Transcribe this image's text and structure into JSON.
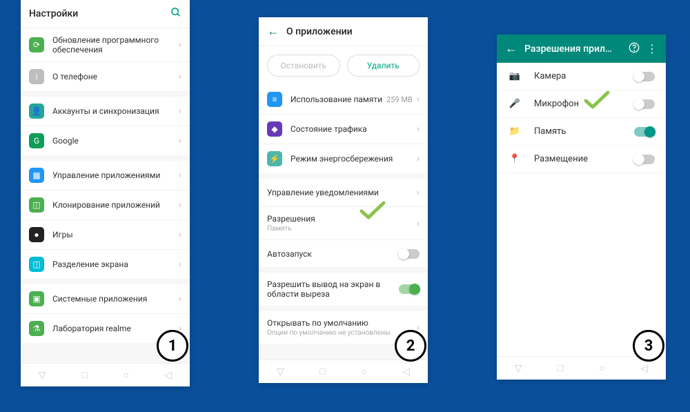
{
  "phone1": {
    "title": "Настройки",
    "groups": [
      [
        {
          "icon": "ic-green",
          "glyph": "⟳",
          "label": "Обновление программного обеспечения"
        },
        {
          "icon": "ic-gray",
          "glyph": "i",
          "label": "О телефоне"
        }
      ],
      [
        {
          "icon": "ic-teal",
          "glyph": "👤",
          "label": "Аккаунты и синхронизация"
        },
        {
          "icon": "ic-ggreen",
          "glyph": "G",
          "label": "Google"
        }
      ],
      [
        {
          "icon": "ic-blue",
          "glyph": "▦",
          "label": "Управление приложениями"
        },
        {
          "icon": "ic-green",
          "glyph": "◫",
          "label": "Клонирование приложений"
        },
        {
          "icon": "ic-dark",
          "glyph": "●",
          "label": "Игры"
        },
        {
          "icon": "ic-cyan",
          "glyph": "◫",
          "label": "Разделение экрана"
        }
      ],
      [
        {
          "icon": "ic-green",
          "glyph": "▣",
          "label": "Системные приложения"
        },
        {
          "icon": "ic-green",
          "glyph": "⚗",
          "label": "Лаборатория realme"
        }
      ]
    ]
  },
  "phone2": {
    "title": "О приложении",
    "btnStop": "Остановить",
    "btnDelete": "Удалить",
    "group1": [
      {
        "icon": "ic-blue",
        "glyph": "≡",
        "label": "Использование памяти",
        "value": "259 MB"
      },
      {
        "icon": "ic-purple",
        "glyph": "◆",
        "label": "Состояние трафика"
      },
      {
        "icon": "ic-mint",
        "glyph": "⚡",
        "label": "Режим энергосбережения"
      }
    ],
    "group2": [
      {
        "label": "Управление уведомлениями",
        "chevron": true
      },
      {
        "label": "Разрешения",
        "sublabel": "Память",
        "chevron": true
      },
      {
        "label": "Автозапуск",
        "toggle": "off"
      }
    ],
    "group3": [
      {
        "label": "Разрешить вывод на экран в области выреза",
        "toggle": "sm-on"
      }
    ],
    "group4": [
      {
        "label": "Открывать по умолчанию",
        "sublabel": "Опции по умолчанию не установлены"
      }
    ]
  },
  "phone3": {
    "title": "Разрешения прил…",
    "items": [
      {
        "glyph": "📷",
        "label": "Камера",
        "on": false
      },
      {
        "glyph": "🎤",
        "label": "Микрофон",
        "on": false
      },
      {
        "glyph": "📁",
        "label": "Память",
        "on": true
      },
      {
        "glyph": "📍",
        "label": "Размещение",
        "on": false
      }
    ]
  },
  "badges": {
    "b1": "1",
    "b2": "2",
    "b3": "3"
  }
}
